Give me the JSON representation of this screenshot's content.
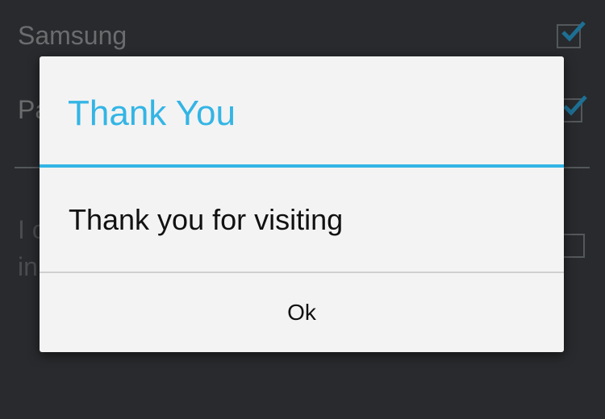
{
  "background": {
    "items": [
      {
        "label": "Samsung",
        "checked": true
      },
      {
        "label": "Pa",
        "checked": true
      }
    ],
    "paragraph_lines": [
      "I c",
      "in"
    ]
  },
  "dialog": {
    "title": "Thank You",
    "message": "Thank you for visiting",
    "ok_label": "Ok"
  },
  "colors": {
    "accent": "#33b5e5",
    "dialog_bg": "#f3f3f3",
    "screen_bg": "#282a2d"
  },
  "icons": {
    "checkbox_checked": "checkmark-icon"
  }
}
